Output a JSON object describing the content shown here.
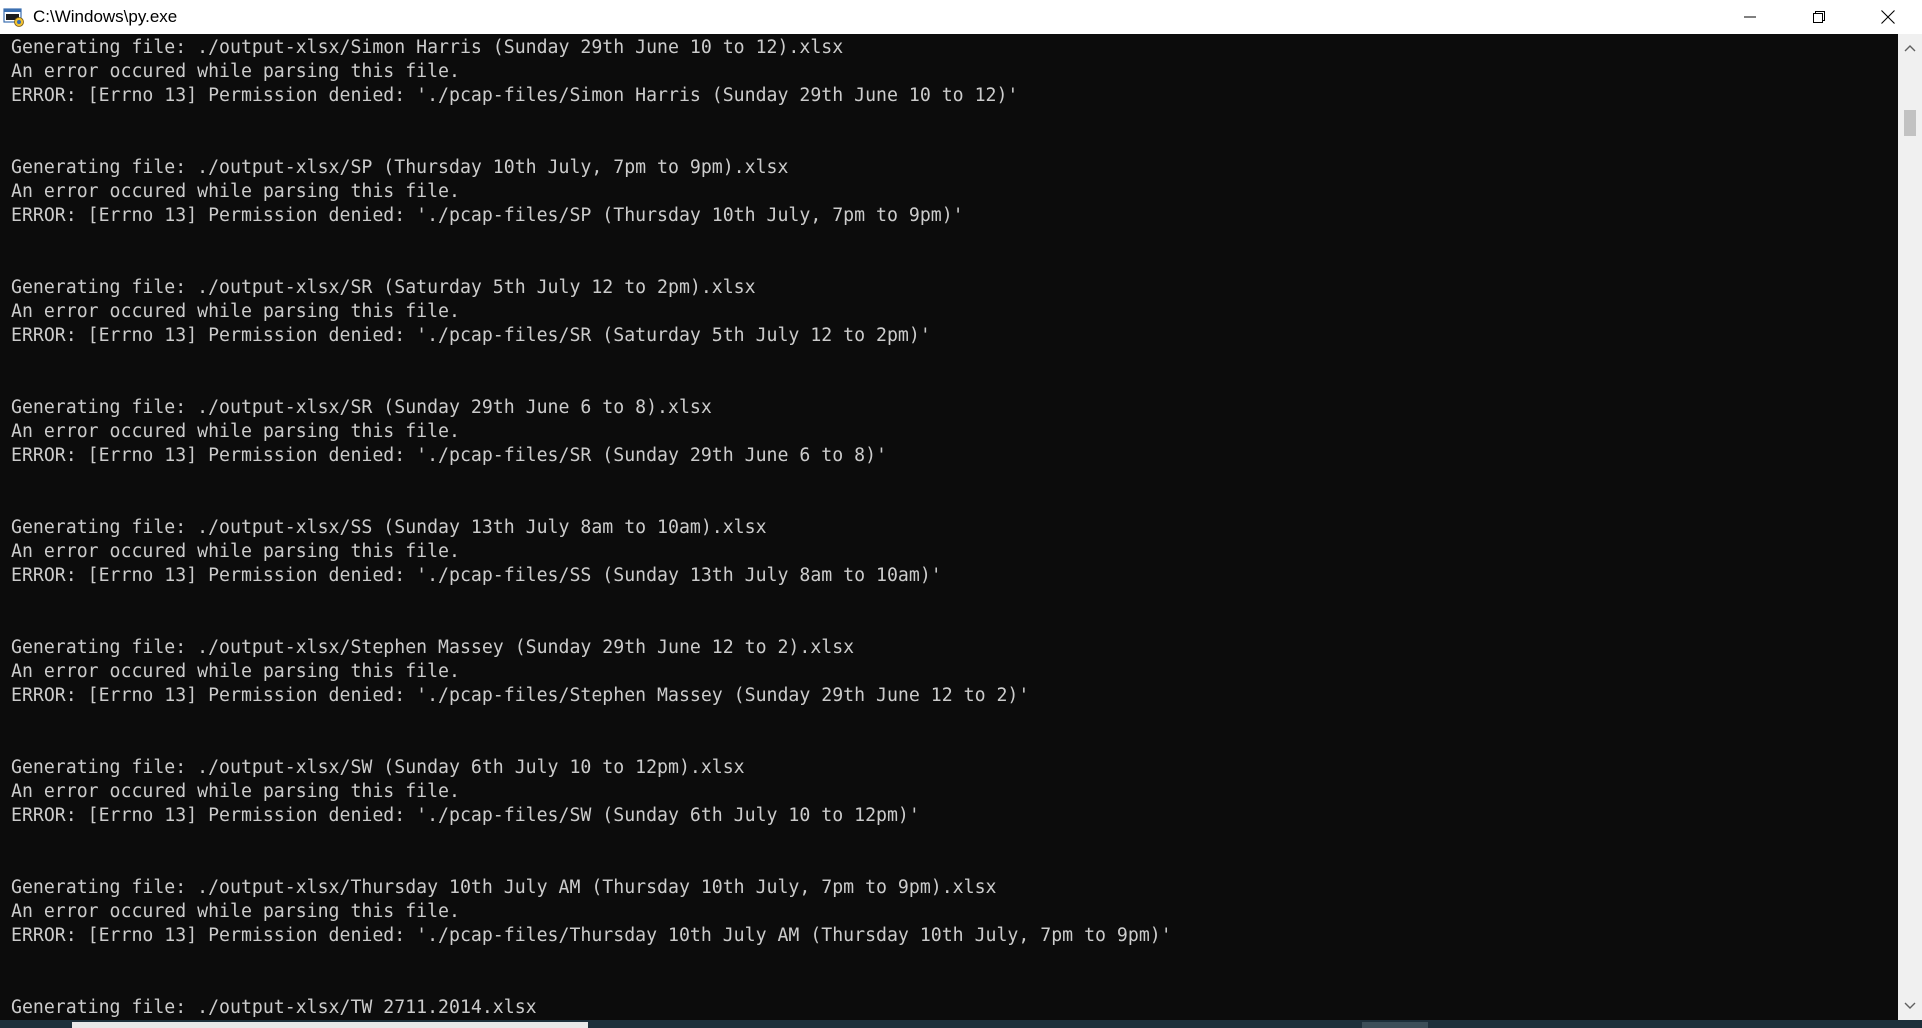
{
  "window": {
    "title": "C:\\Windows\\py.exe",
    "app_icon": "python-console-icon",
    "controls": {
      "minimize_icon": "minimize-icon",
      "restore_icon": "restore-icon",
      "close_icon": "close-icon"
    }
  },
  "colors": {
    "console_background": "#0c0c0c",
    "console_text": "#cccccc",
    "titlebar_background": "#ffffff",
    "scrollbar_track": "#f0f0f0",
    "scrollbar_thumb": "#c2c2c2"
  },
  "console": {
    "lines": [
      "Generating file: ./output-xlsx/Simon Harris (Sunday 29th June 10 to 12).xlsx",
      "An error occured while parsing this file.",
      "ERROR: [Errno 13] Permission denied: './pcap-files/Simon Harris (Sunday 29th June 10 to 12)'",
      "",
      "",
      "Generating file: ./output-xlsx/SP (Thursday 10th July, 7pm to 9pm).xlsx",
      "An error occured while parsing this file.",
      "ERROR: [Errno 13] Permission denied: './pcap-files/SP (Thursday 10th July, 7pm to 9pm)'",
      "",
      "",
      "Generating file: ./output-xlsx/SR (Saturday 5th July 12 to 2pm).xlsx",
      "An error occured while parsing this file.",
      "ERROR: [Errno 13] Permission denied: './pcap-files/SR (Saturday 5th July 12 to 2pm)'",
      "",
      "",
      "Generating file: ./output-xlsx/SR (Sunday 29th June 6 to 8).xlsx",
      "An error occured while parsing this file.",
      "ERROR: [Errno 13] Permission denied: './pcap-files/SR (Sunday 29th June 6 to 8)'",
      "",
      "",
      "Generating file: ./output-xlsx/SS (Sunday 13th July 8am to 10am).xlsx",
      "An error occured while parsing this file.",
      "ERROR: [Errno 13] Permission denied: './pcap-files/SS (Sunday 13th July 8am to 10am)'",
      "",
      "",
      "Generating file: ./output-xlsx/Stephen Massey (Sunday 29th June 12 to 2).xlsx",
      "An error occured while parsing this file.",
      "ERROR: [Errno 13] Permission denied: './pcap-files/Stephen Massey (Sunday 29th June 12 to 2)'",
      "",
      "",
      "Generating file: ./output-xlsx/SW (Sunday 6th July 10 to 12pm).xlsx",
      "An error occured while parsing this file.",
      "ERROR: [Errno 13] Permission denied: './pcap-files/SW (Sunday 6th July 10 to 12pm)'",
      "",
      "",
      "Generating file: ./output-xlsx/Thursday 10th July AM (Thursday 10th July, 7pm to 9pm).xlsx",
      "An error occured while parsing this file.",
      "ERROR: [Errno 13] Permission denied: './pcap-files/Thursday 10th July AM (Thursday 10th July, 7pm to 9pm)'",
      "",
      "",
      "Generating file: ./output-xlsx/TW 2711.2014.xlsx"
    ]
  },
  "scrollbar": {
    "up_icon": "scroll-up-arrow-icon",
    "down_icon": "scroll-down-arrow-icon"
  }
}
